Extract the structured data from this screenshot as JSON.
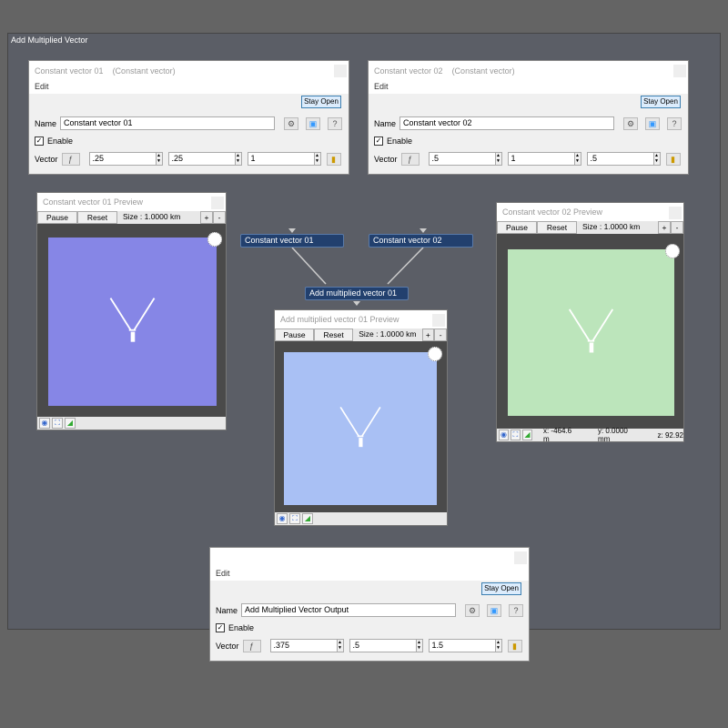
{
  "window": {
    "title": "Add Multiplied Vector"
  },
  "dialogs": [
    {
      "title": "Constant vector 01",
      "subtitle": "(Constant vector)",
      "menu": "Edit",
      "stay_open": "Stay Open",
      "name_label": "Name",
      "name_value": "Constant vector 01",
      "enable_label": "Enable",
      "enabled": true,
      "vector_label": "Vector",
      "values": [
        ".25",
        ".25",
        "1"
      ]
    },
    {
      "title": "Constant vector 02",
      "subtitle": "(Constant vector)",
      "menu": "Edit",
      "stay_open": "Stay Open",
      "name_label": "Name",
      "name_value": "Constant vector 02",
      "enable_label": "Enable",
      "enabled": true,
      "vector_label": "Vector",
      "values": [
        ".5",
        "1",
        ".5"
      ]
    },
    {
      "title": "",
      "subtitle": "",
      "menu": "Edit",
      "stay_open": "Stay Open",
      "name_label": "Name",
      "name_value": "Add Multiplied Vector Output",
      "enable_label": "Enable",
      "enabled": true,
      "vector_label": "Vector",
      "values": [
        ".375",
        ".5",
        "1.5"
      ]
    }
  ],
  "previews": [
    {
      "title": "Constant vector 01 Preview",
      "pause": "Pause",
      "reset": "Reset",
      "size": "Size : 1.0000 km",
      "plus": "+",
      "minus": "-",
      "color": "#8686e6",
      "status": {}
    },
    {
      "title": "Constant vector 02 Preview",
      "pause": "Pause",
      "reset": "Reset",
      "size": "Size : 1.0000 km",
      "plus": "+",
      "minus": "-",
      "color": "#bce5bb",
      "status": {
        "x": "x: -464.6 m",
        "y": "y: 0.0000 mm",
        "z": "z: 92.92"
      }
    },
    {
      "title": "Add multiplied vector 01 Preview",
      "pause": "Pause",
      "reset": "Reset",
      "size": "Size : 1.0000 km",
      "plus": "+",
      "minus": "-",
      "color": "#a9c0f4",
      "status": {}
    }
  ],
  "nodes": [
    "Constant vector 01",
    "Constant vector 02",
    "Add multiplied vector 01"
  ]
}
